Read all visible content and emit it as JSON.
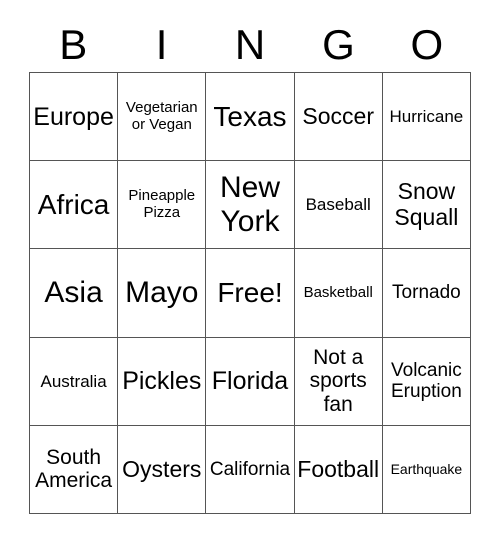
{
  "card": {
    "title": "BINGO",
    "header_letters": [
      "B",
      "I",
      "N",
      "G",
      "O"
    ],
    "colors": {
      "border": "#555555",
      "text": "#000000",
      "background": "#ffffff"
    },
    "grid_size": "5x5",
    "free_space": "Free!",
    "cells": [
      {
        "text": "Europe",
        "size": "fs-lg",
        "row": 1,
        "col": 1
      },
      {
        "text": "Vegetarian\nor Vegan",
        "size": "fs-tiny",
        "row": 1,
        "col": 2
      },
      {
        "text": "Texas",
        "size": "fs-xl",
        "row": 1,
        "col": 3
      },
      {
        "text": "Soccer",
        "size": "fs-md",
        "row": 1,
        "col": 4
      },
      {
        "text": "Hurricane",
        "size": "fs-xxs",
        "row": 1,
        "col": 5
      },
      {
        "text": "Africa",
        "size": "fs-xl",
        "row": 2,
        "col": 1
      },
      {
        "text": "Pineapple\nPizza",
        "size": "fs-tiny",
        "row": 2,
        "col": 2
      },
      {
        "text": "New\nYork",
        "size": "fs-xxl",
        "row": 2,
        "col": 3
      },
      {
        "text": "Baseball",
        "size": "fs-xxs",
        "row": 2,
        "col": 4
      },
      {
        "text": "Snow\nSquall",
        "size": "fs-md",
        "row": 2,
        "col": 5
      },
      {
        "text": "Asia",
        "size": "fs-xxl",
        "row": 3,
        "col": 1
      },
      {
        "text": "Mayo",
        "size": "fs-xxl",
        "row": 3,
        "col": 2
      },
      {
        "text": "Free!",
        "size": "fs-xl",
        "row": 3,
        "col": 3
      },
      {
        "text": "Basketball",
        "size": "fs-tiny",
        "row": 3,
        "col": 4
      },
      {
        "text": "Tornado",
        "size": "fs-xs",
        "row": 3,
        "col": 5
      },
      {
        "text": "Australia",
        "size": "fs-xxs",
        "row": 4,
        "col": 1
      },
      {
        "text": "Pickles",
        "size": "fs-lg",
        "row": 4,
        "col": 2
      },
      {
        "text": "Florida",
        "size": "fs-lg",
        "row": 4,
        "col": 3
      },
      {
        "text": "Not a\nsports\nfan",
        "size": "fs-sm",
        "row": 4,
        "col": 4
      },
      {
        "text": "Volcanic\nEruption",
        "size": "fs-xs",
        "row": 4,
        "col": 5
      },
      {
        "text": "South\nAmerica",
        "size": "fs-sm",
        "row": 5,
        "col": 1
      },
      {
        "text": "Oysters",
        "size": "fs-md",
        "row": 5,
        "col": 2
      },
      {
        "text": "California",
        "size": "fs-xs",
        "row": 5,
        "col": 3
      },
      {
        "text": "Football",
        "size": "fs-md",
        "row": 5,
        "col": 4
      },
      {
        "text": "Earthquake",
        "size": "fs-micro",
        "row": 5,
        "col": 5
      }
    ]
  }
}
